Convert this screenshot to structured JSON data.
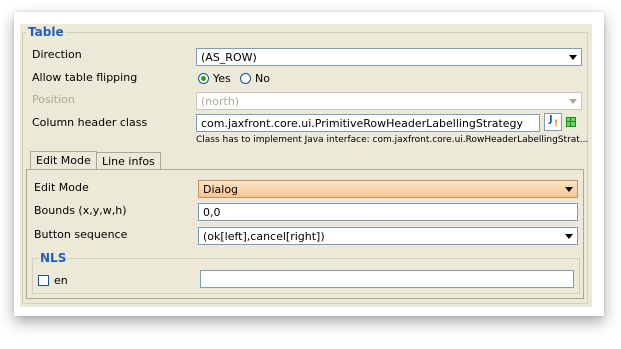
{
  "table": {
    "legend": "Table",
    "direction": {
      "label": "Direction",
      "value": "(AS_ROW)"
    },
    "flipping": {
      "label": "Allow table flipping",
      "yes": "Yes",
      "no": "No",
      "selected": "Yes"
    },
    "position": {
      "label": "Position",
      "value": "(north)"
    },
    "column_header": {
      "label": "Column header class",
      "value": "com.jaxfront.core.ui.PrimitiveRowHeaderLabellingStrategy",
      "hint": "Class has to implement Java interface:  com.jaxfront.core.ui.RowHeaderLabellingStrat..."
    }
  },
  "tabs": [
    {
      "label": "Edit Mode",
      "active": true
    },
    {
      "label": "Line infos",
      "active": false
    }
  ],
  "edit": {
    "mode": {
      "label": "Edit Mode",
      "value": "Dialog"
    },
    "bounds": {
      "label": "Bounds (x,y,w,h)",
      "value": "0,0"
    },
    "buttons": {
      "label": "Button sequence",
      "value": "(ok[left],cancel[right])"
    }
  },
  "nls": {
    "legend": "NLS",
    "lang": "en",
    "value": ""
  },
  "colors": {
    "legend": "#1f5fbf",
    "panel": "#ece9d8",
    "radio_dot": "#21a121",
    "orange_combo": "#f7c690"
  }
}
